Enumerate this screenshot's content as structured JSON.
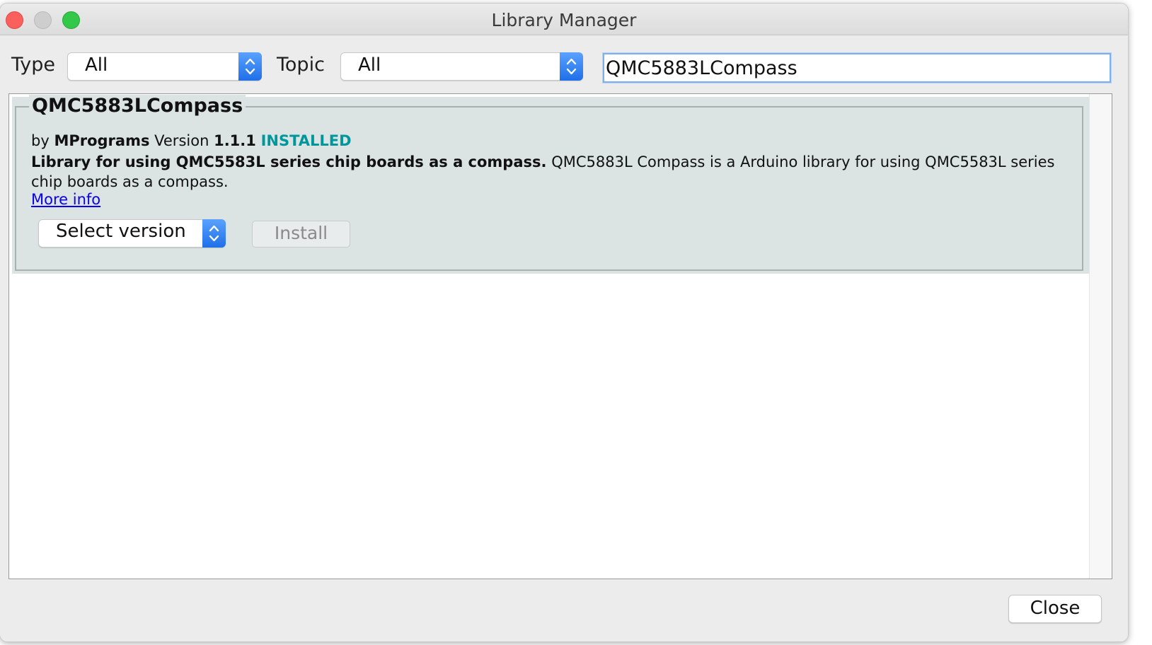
{
  "window": {
    "title": "Library Manager"
  },
  "filters": {
    "type_label": "Type",
    "type_value": "All",
    "topic_label": "Topic",
    "topic_value": "All",
    "search_value": "QMC5883LCompass"
  },
  "library": {
    "name": "QMC5883LCompass",
    "by_label": "by",
    "author": "MPrograms",
    "version_label": "Version",
    "version": "1.1.1",
    "status": "INSTALLED",
    "summary": "Library for using QMC5583L series chip boards as a compass.",
    "description": "QMC5883L Compass is a Arduino library for using QMC5583L series chip boards as a compass.",
    "more_info": "More info",
    "version_select": "Select version",
    "install_label": "Install"
  },
  "footer": {
    "close_label": "Close"
  },
  "colors": {
    "installed": "#00979c",
    "link": "#0b00ee",
    "item_background": "#dbe3e3",
    "stepper_blue": "#1f6fe8"
  },
  "icons": [
    "chevron-up-down-icon"
  ]
}
